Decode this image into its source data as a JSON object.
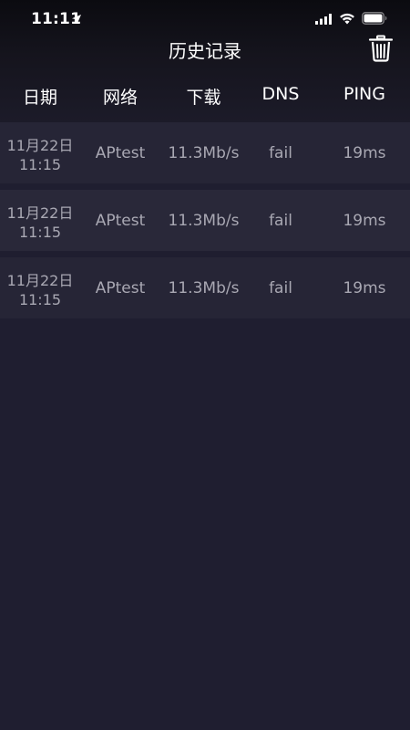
{
  "status_bar": {
    "time": "11:11"
  },
  "nav": {
    "title": "历史记录"
  },
  "table": {
    "columns": [
      "日期",
      "网络",
      "下载",
      "DNS",
      "PING"
    ],
    "rows": [
      {
        "date": "11月22日",
        "time": "11:15",
        "network": "APtest",
        "download": "11.3Mb/s",
        "dns": "fail",
        "ping": "19ms"
      },
      {
        "date": "11月22日",
        "time": "11:15",
        "network": "APtest",
        "download": "11.3Mb/s",
        "dns": "fail",
        "ping": "19ms"
      },
      {
        "date": "11月22日",
        "time": "11:15",
        "network": "APtest",
        "download": "11.3Mb/s",
        "dns": "fail",
        "ping": "19ms"
      }
    ]
  },
  "colors": {
    "background": "#1f1e30",
    "row_background": "#262536",
    "cell_text": "#a9a8b3",
    "header_text": "#ffffff"
  },
  "icons": {
    "location": "location-arrow-icon",
    "signal": "cellular-signal-icon",
    "wifi": "wifi-icon",
    "battery": "battery-icon",
    "trash": "trash-icon"
  }
}
